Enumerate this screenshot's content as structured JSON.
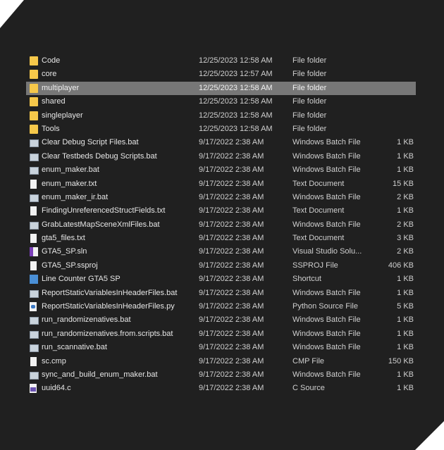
{
  "files": [
    {
      "name": "Code",
      "date": "12/25/2023 12:58 AM",
      "type": "File folder",
      "size": "",
      "icon": "folder"
    },
    {
      "name": "core",
      "date": "12/25/2023 12:57 AM",
      "type": "File folder",
      "size": "",
      "icon": "folder"
    },
    {
      "name": "multiplayer",
      "date": "12/25/2023 12:58 AM",
      "type": "File folder",
      "size": "",
      "icon": "folder",
      "selected": true
    },
    {
      "name": "shared",
      "date": "12/25/2023 12:58 AM",
      "type": "File folder",
      "size": "",
      "icon": "folder"
    },
    {
      "name": "singleplayer",
      "date": "12/25/2023 12:58 AM",
      "type": "File folder",
      "size": "",
      "icon": "folder"
    },
    {
      "name": "Tools",
      "date": "12/25/2023 12:58 AM",
      "type": "File folder",
      "size": "",
      "icon": "folder"
    },
    {
      "name": "Clear Debug Script Files.bat",
      "date": "9/17/2022 2:38 AM",
      "type": "Windows Batch File",
      "size": "1 KB",
      "icon": "bat"
    },
    {
      "name": "Clear Testbeds Debug Scripts.bat",
      "date": "9/17/2022 2:38 AM",
      "type": "Windows Batch File",
      "size": "1 KB",
      "icon": "bat"
    },
    {
      "name": "enum_maker.bat",
      "date": "9/17/2022 2:38 AM",
      "type": "Windows Batch File",
      "size": "1 KB",
      "icon": "bat"
    },
    {
      "name": "enum_maker.txt",
      "date": "9/17/2022 2:38 AM",
      "type": "Text Document",
      "size": "15 KB",
      "icon": "txt"
    },
    {
      "name": "enum_maker_ir.bat",
      "date": "9/17/2022 2:38 AM",
      "type": "Windows Batch File",
      "size": "2 KB",
      "icon": "bat"
    },
    {
      "name": "FindingUnreferencedStructFields.txt",
      "date": "9/17/2022 2:38 AM",
      "type": "Text Document",
      "size": "1 KB",
      "icon": "txt"
    },
    {
      "name": "GrabLatestMapSceneXmlFiles.bat",
      "date": "9/17/2022 2:38 AM",
      "type": "Windows Batch File",
      "size": "2 KB",
      "icon": "bat"
    },
    {
      "name": "gta5_files.txt",
      "date": "9/17/2022 2:38 AM",
      "type": "Text Document",
      "size": "3 KB",
      "icon": "txt"
    },
    {
      "name": "GTA5_SP.sln",
      "date": "9/17/2022 2:38 AM",
      "type": "Visual Studio Solu...",
      "size": "2 KB",
      "icon": "sln"
    },
    {
      "name": "GTA5_SP.ssproj",
      "date": "9/17/2022 2:38 AM",
      "type": "SSPROJ File",
      "size": "406 KB",
      "icon": "txt"
    },
    {
      "name": "Line Counter GTA5 SP",
      "date": "9/17/2022 2:38 AM",
      "type": "Shortcut",
      "size": "1 KB",
      "icon": "lnk"
    },
    {
      "name": "ReportStaticVariablesInHeaderFiles.bat",
      "date": "9/17/2022 2:38 AM",
      "type": "Windows Batch File",
      "size": "1 KB",
      "icon": "bat"
    },
    {
      "name": "ReportStaticVariablesInHeaderFiles.py",
      "date": "9/17/2022 2:38 AM",
      "type": "Python Source File",
      "size": "5 KB",
      "icon": "py"
    },
    {
      "name": "run_randomizenatives.bat",
      "date": "9/17/2022 2:38 AM",
      "type": "Windows Batch File",
      "size": "1 KB",
      "icon": "bat"
    },
    {
      "name": "run_randomizenatives.from.scripts.bat",
      "date": "9/17/2022 2:38 AM",
      "type": "Windows Batch File",
      "size": "1 KB",
      "icon": "bat"
    },
    {
      "name": "run_scannative.bat",
      "date": "9/17/2022 2:38 AM",
      "type": "Windows Batch File",
      "size": "1 KB",
      "icon": "bat"
    },
    {
      "name": "sc.cmp",
      "date": "9/17/2022 2:38 AM",
      "type": "CMP File",
      "size": "150 KB",
      "icon": "txt"
    },
    {
      "name": "sync_and_build_enum_maker.bat",
      "date": "9/17/2022 2:38 AM",
      "type": "Windows Batch File",
      "size": "1 KB",
      "icon": "bat"
    },
    {
      "name": "uuid64.c",
      "date": "9/17/2022 2:38 AM",
      "type": "C Source",
      "size": "1 KB",
      "icon": "c"
    }
  ],
  "colors": {
    "background": "#202020",
    "selection": "#777777",
    "folder": "#f6c84a"
  }
}
